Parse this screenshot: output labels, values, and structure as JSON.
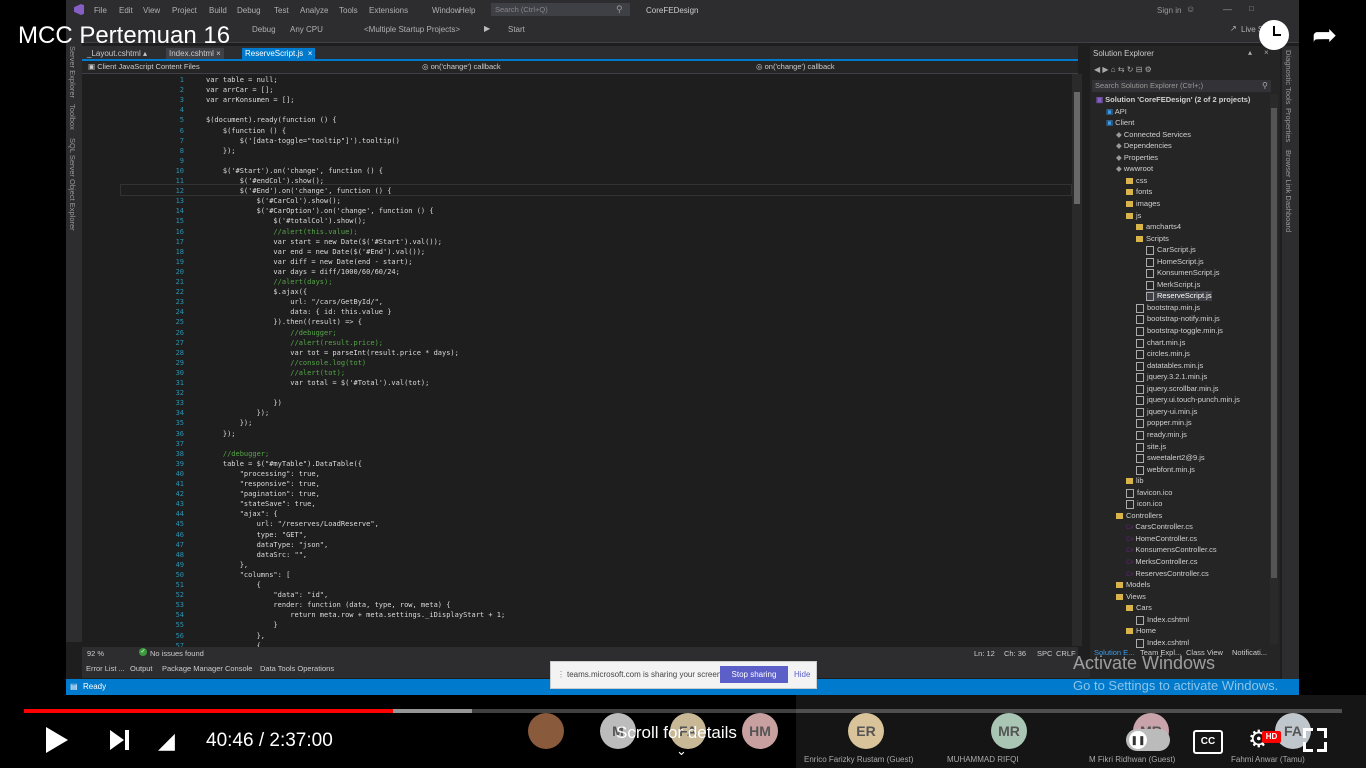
{
  "video": {
    "title": "MCC Pertemuan 16",
    "time_current": "40:46",
    "time_separator": " / ",
    "time_total": "2:37:00",
    "progress": 0.28,
    "buffered": 0.34,
    "scroll_hint": "Scroll for details",
    "hd_badge": "HD"
  },
  "vs": {
    "menu": [
      "File",
      "Edit",
      "View",
      "Project",
      "Build",
      "Debug",
      "Test",
      "Analyze",
      "Tools",
      "Extensions",
      "Window",
      "Help"
    ],
    "search_placeholder": "Search (Ctrl+Q)",
    "solution_title": "CoreFEDesign",
    "sign_in": "Sign in",
    "live_share": "Live Share",
    "toolbar": {
      "config": "Debug",
      "platform": "Any CPU",
      "startup": "<Multiple Startup Projects>",
      "start": "Start"
    },
    "tabs": [
      "_Layout.cshtml",
      "Index.cshtml",
      "ReserveScript.js"
    ],
    "left_side_tabs": [
      "Server Explorer",
      "Toolbox",
      "SQL Server Object Explorer"
    ],
    "right_side_tabs": [
      "Diagnostic Tools",
      "Properties",
      "Browser Link Dashboard"
    ],
    "nav": {
      "project": "Client JavaScript Content Files",
      "scope1": "on('change') callback",
      "scope2": "on('change') callback"
    },
    "code_lines": [
      {
        "n": "1",
        "t": "var table = null;"
      },
      {
        "n": "2",
        "t": "var arrCar = [];"
      },
      {
        "n": "3",
        "t": "var arrKonsumen = [];"
      },
      {
        "n": "4",
        "t": ""
      },
      {
        "n": "5",
        "t": "$(document).ready(function () {"
      },
      {
        "n": "6",
        "t": "    $(function () {"
      },
      {
        "n": "7",
        "t": "        $('[data-toggle=\"tooltip\"]').tooltip()"
      },
      {
        "n": "8",
        "t": "    });"
      },
      {
        "n": "9",
        "t": ""
      },
      {
        "n": "10",
        "t": "    $('#Start').on('change', function () {"
      },
      {
        "n": "11",
        "t": "        $('#endCol').show();"
      },
      {
        "n": "12",
        "t": "        $('#End').on('change', function () {"
      },
      {
        "n": "13",
        "t": "            $('#CarCol').show();"
      },
      {
        "n": "14",
        "t": "            $('#CarOption').on('change', function () {"
      },
      {
        "n": "15",
        "t": "                $('#totalCol').show();"
      },
      {
        "n": "16",
        "t": "                //alert(this.value);"
      },
      {
        "n": "17",
        "t": "                var start = new Date($('#Start').val());"
      },
      {
        "n": "18",
        "t": "                var end = new Date($('#End').val());"
      },
      {
        "n": "19",
        "t": "                var diff = new Date(end - start);"
      },
      {
        "n": "20",
        "t": "                var days = diff/1000/60/60/24;"
      },
      {
        "n": "21",
        "t": "                //alert(days);"
      },
      {
        "n": "22",
        "t": "                $.ajax({"
      },
      {
        "n": "23",
        "t": "                    url: \"/cars/GetById/\","
      },
      {
        "n": "24",
        "t": "                    data: { id: this.value }"
      },
      {
        "n": "25",
        "t": "                }).then((result) => {"
      },
      {
        "n": "26",
        "t": "                    //debugger;"
      },
      {
        "n": "27",
        "t": "                    //alert(result.price);"
      },
      {
        "n": "28",
        "t": "                    var tot = parseInt(result.price * days);"
      },
      {
        "n": "29",
        "t": "                    //console.log(tot)"
      },
      {
        "n": "30",
        "t": "                    //alert(tot);"
      },
      {
        "n": "31",
        "t": "                    var total = $('#Total').val(tot);"
      },
      {
        "n": "32",
        "t": ""
      },
      {
        "n": "33",
        "t": "                })"
      },
      {
        "n": "34",
        "t": "            });"
      },
      {
        "n": "35",
        "t": "        });"
      },
      {
        "n": "36",
        "t": "    });"
      },
      {
        "n": "37",
        "t": ""
      },
      {
        "n": "38",
        "t": "    //debugger;"
      },
      {
        "n": "39",
        "t": "    table = $(\"#myTable\").DataTable({"
      },
      {
        "n": "40",
        "t": "        \"processing\": true,"
      },
      {
        "n": "41",
        "t": "        \"responsive\": true,"
      },
      {
        "n": "42",
        "t": "        \"pagination\": true,"
      },
      {
        "n": "43",
        "t": "        \"stateSave\": true,"
      },
      {
        "n": "44",
        "t": "        \"ajax\": {"
      },
      {
        "n": "45",
        "t": "            url: \"/reserves/LoadReserve\","
      },
      {
        "n": "46",
        "t": "            type: \"GET\","
      },
      {
        "n": "47",
        "t": "            dataType: \"json\","
      },
      {
        "n": "48",
        "t": "            dataSrc: \"\","
      },
      {
        "n": "49",
        "t": "        },"
      },
      {
        "n": "50",
        "t": "        \"columns\": ["
      },
      {
        "n": "51",
        "t": "            {"
      },
      {
        "n": "52",
        "t": "                \"data\": \"id\","
      },
      {
        "n": "53",
        "t": "                render: function (data, type, row, meta) {"
      },
      {
        "n": "54",
        "t": "                    return meta.row + meta.settings._iDisplayStart + 1;"
      },
      {
        "n": "55",
        "t": "                }"
      },
      {
        "n": "56",
        "t": "            },"
      },
      {
        "n": "57",
        "t": "            {"
      }
    ],
    "zoom": "92 %",
    "issues": "No issues found",
    "ln": "Ln: 12",
    "ch": "Ch: 36",
    "spc": "SPC",
    "crlf": "CRLF",
    "bottom_tabs": [
      "Error List ...",
      "Output",
      "Package Manager Console",
      "Data Tools Operations"
    ],
    "status_ready": "Ready",
    "solution_explorer": {
      "title": "Solution Explorer",
      "search_placeholder": "Search Solution Explorer (Ctrl+;)",
      "items": [
        {
          "label": "Solution 'CoreFEDesign' (2 of 2 projects)",
          "indent": 0,
          "type": "solution"
        },
        {
          "label": "API",
          "indent": 1,
          "type": "project"
        },
        {
          "label": "Client",
          "indent": 1,
          "type": "project"
        },
        {
          "label": "Connected Services",
          "indent": 2,
          "type": "node"
        },
        {
          "label": "Dependencies",
          "indent": 2,
          "type": "node"
        },
        {
          "label": "Properties",
          "indent": 2,
          "type": "node"
        },
        {
          "label": "wwwroot",
          "indent": 2,
          "type": "node"
        },
        {
          "label": "css",
          "indent": 3,
          "type": "folder"
        },
        {
          "label": "fonts",
          "indent": 3,
          "type": "folder"
        },
        {
          "label": "images",
          "indent": 3,
          "type": "folder"
        },
        {
          "label": "js",
          "indent": 3,
          "type": "folder"
        },
        {
          "label": "amcharts4",
          "indent": 4,
          "type": "folder"
        },
        {
          "label": "Scripts",
          "indent": 4,
          "type": "folder"
        },
        {
          "label": "CarScript.js",
          "indent": 5,
          "type": "file"
        },
        {
          "label": "HomeScript.js",
          "indent": 5,
          "type": "file"
        },
        {
          "label": "KonsumenScript.js",
          "indent": 5,
          "type": "file"
        },
        {
          "label": "MerkScript.js",
          "indent": 5,
          "type": "file"
        },
        {
          "label": "ReserveScript.js",
          "indent": 5,
          "type": "file",
          "selected": true
        },
        {
          "label": "bootstrap.min.js",
          "indent": 4,
          "type": "file"
        },
        {
          "label": "bootstrap-notify.min.js",
          "indent": 4,
          "type": "file"
        },
        {
          "label": "bootstrap-toggle.min.js",
          "indent": 4,
          "type": "file"
        },
        {
          "label": "chart.min.js",
          "indent": 4,
          "type": "file"
        },
        {
          "label": "circles.min.js",
          "indent": 4,
          "type": "file"
        },
        {
          "label": "datatables.min.js",
          "indent": 4,
          "type": "file"
        },
        {
          "label": "jquery.3.2.1.min.js",
          "indent": 4,
          "type": "file"
        },
        {
          "label": "jquery.scrollbar.min.js",
          "indent": 4,
          "type": "file"
        },
        {
          "label": "jquery.ui.touch-punch.min.js",
          "indent": 4,
          "type": "file"
        },
        {
          "label": "jquery-ui.min.js",
          "indent": 4,
          "type": "file"
        },
        {
          "label": "popper.min.js",
          "indent": 4,
          "type": "file"
        },
        {
          "label": "ready.min.js",
          "indent": 4,
          "type": "file"
        },
        {
          "label": "site.js",
          "indent": 4,
          "type": "file"
        },
        {
          "label": "sweetalert2@9.js",
          "indent": 4,
          "type": "file"
        },
        {
          "label": "webfont.min.js",
          "indent": 4,
          "type": "file"
        },
        {
          "label": "lib",
          "indent": 3,
          "type": "folder"
        },
        {
          "label": "favicon.ico",
          "indent": 3,
          "type": "file"
        },
        {
          "label": "icon.ico",
          "indent": 3,
          "type": "file"
        },
        {
          "label": "Controllers",
          "indent": 2,
          "type": "folder"
        },
        {
          "label": "CarsController.cs",
          "indent": 3,
          "type": "cs"
        },
        {
          "label": "HomeController.cs",
          "indent": 3,
          "type": "cs"
        },
        {
          "label": "KonsumensController.cs",
          "indent": 3,
          "type": "cs"
        },
        {
          "label": "MerksController.cs",
          "indent": 3,
          "type": "cs"
        },
        {
          "label": "ReservesController.cs",
          "indent": 3,
          "type": "cs"
        },
        {
          "label": "Models",
          "indent": 2,
          "type": "folder"
        },
        {
          "label": "Views",
          "indent": 2,
          "type": "folder"
        },
        {
          "label": "Cars",
          "indent": 3,
          "type": "folder"
        },
        {
          "label": "Index.cshtml",
          "indent": 4,
          "type": "file"
        },
        {
          "label": "Home",
          "indent": 3,
          "type": "folder"
        },
        {
          "label": "Index.cshtml",
          "indent": 4,
          "type": "file"
        }
      ],
      "bottom_tabs": [
        "Solution E...",
        "Team Expl...",
        "Class View",
        "Notificati..."
      ]
    }
  },
  "teams_bar": {
    "message": "teams.microsoft.com is sharing your screen.",
    "stop": "Stop sharing",
    "hide": "Hide"
  },
  "watermark": {
    "line1": "Activate Windows",
    "line2": "Go to Settings to activate Windows."
  },
  "participants": [
    {
      "initials": "",
      "name": "",
      "color": "#8a5a3c"
    },
    {
      "initials": "M",
      "name": "",
      "color": "#bcbcbc"
    },
    {
      "initials": "FA",
      "name": "",
      "color": "#c8b895"
    },
    {
      "initials": "HM",
      "name": "",
      "color": "#c8a0a0"
    },
    {
      "initials": "ER",
      "name": "Enrico Farizky Rustam (Guest)",
      "color": "#d8c39a"
    },
    {
      "initials": "MR",
      "name": "MUHAMMAD RIFQI",
      "color": "#a9c6b4"
    },
    {
      "initials": "MR",
      "name": "M Fikri Ridhwan (Guest)",
      "color": "#c9a3aa"
    },
    {
      "initials": "FA",
      "name": "Fahmi Anwar (Tamu)",
      "color": "#bfc6cc"
    }
  ]
}
